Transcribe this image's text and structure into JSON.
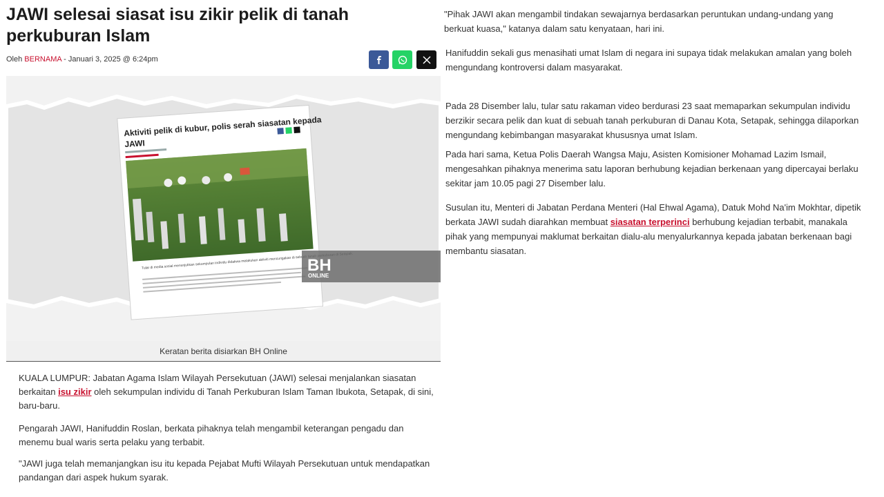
{
  "article": {
    "headline": "JAWI selesai siasat isu zikir pelik di tanah perkuburan Islam",
    "byline_prefix": "Oleh ",
    "author": "BERNAMA",
    "date": " - Januari 3, 2025 @ 6:24pm"
  },
  "share": {
    "facebook_icon": "facebook-icon",
    "whatsapp_icon": "whatsapp-icon",
    "x_icon": "x-icon"
  },
  "hero": {
    "clipping_title": "Aktiviti pelik di kubur, polis serah siasatan kepada JAWI",
    "clipping_caption": "Tular di media sosial menunjukkan sekumpulan individu didakwa melakukan aktiviti mencurigakan di sebuah tanah perkuburan di Setapak.",
    "watermark_big": "BH",
    "watermark_small": "ONLINE",
    "caption": "Keratan berita disiarkan BH Online"
  },
  "body_left": {
    "p1_a": "KUALA LUMPUR: Jabatan Agama Islam Wilayah Persekutuan (JAWI) selesai menjalankan siasatan berkaitan ",
    "p1_link": "isu zikir",
    "p1_b": " oleh sekumpulan individu di Tanah Perkuburan Islam Taman Ibukota, Setapak, di sini, baru-baru.",
    "p2": "Pengarah JAWI, Hanifuddin Roslan, berkata pihaknya telah mengambil keterangan pengadu dan menemu bual waris serta pelaku yang terbabit.",
    "p3": "\"JAWI juga telah memanjangkan isu itu kepada Pejabat Mufti Wilayah Persekutuan untuk mendapatkan pandangan dari aspek hukum syarak."
  },
  "body_right": {
    "p1": "\"Pihak JAWI akan mengambil tindakan sewajarnya berdasarkan peruntukan undang-undang yang berkuat kuasa,\" katanya dalam satu kenyataan, hari ini.",
    "p2": "Hanifuddin sekali gus menasihati umat Islam di negara ini supaya tidak melakukan amalan yang boleh mengundang kontroversi dalam masyarakat.",
    "p3": "Pada 28 Disember lalu, tular satu rakaman video berdurasi 23 saat memaparkan sekumpulan individu berzikir secara pelik dan kuat di sebuah tanah perkuburan di Danau Kota, Setapak, sehingga dilaporkan mengundang kebimbangan masyarakat khususnya umat Islam.",
    "p4": "Pada hari sama, Ketua Polis Daerah Wangsa Maju, Asisten Komisioner Mohamad Lazim Ismail, mengesahkan pihaknya menerima satu laporan berhubung kejadian berkenaan yang dipercayai berlaku sekitar jam 10.05 pagi 27 Disember lalu.",
    "p5_a": "Susulan itu, Menteri di Jabatan Perdana Menteri (Hal Ehwal Agama), Datuk Mohd Na'im Mokhtar, dipetik berkata JAWI sudah diarahkan membuat ",
    "p5_link": "siasatan terperinci",
    "p5_b": " berhubung kejadian terbabit, manakala pihak yang mempunyai maklumat berkaitan dialu-alu menyalurkannya kepada jabatan berkenaan bagi membantu siasatan."
  },
  "colors": {
    "accent": "#c8102e",
    "facebook": "#3b5998",
    "whatsapp": "#25d366",
    "x": "#111111"
  }
}
